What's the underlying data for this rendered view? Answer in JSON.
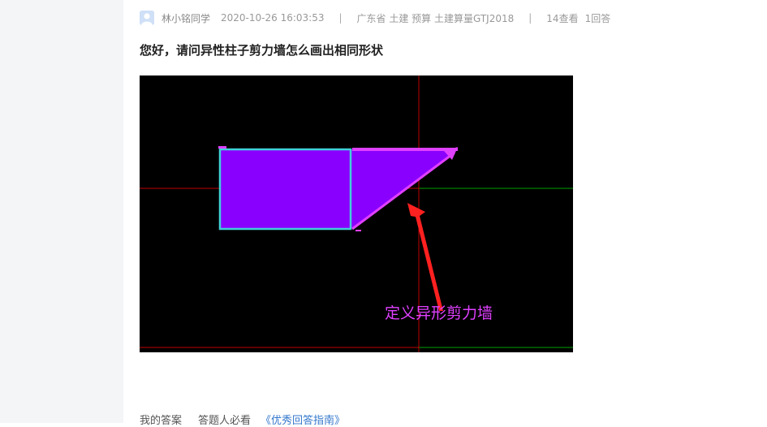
{
  "post": {
    "author": "林小铭同学",
    "date": "2020-10-26 16:03:53",
    "separator": "|",
    "tags": "广东省  土建  预算  土建算量GTJ2018",
    "views": "14查看",
    "answers": "1回答",
    "title": "您好，请问异性柱子剪力墙怎么画出相同形状"
  },
  "image": {
    "annotation_text": "定义异形剪力墙"
  },
  "answer_bar": {
    "my_answer": "我的答案",
    "must_read": "答题人必看",
    "guide_link": "《优秀回答指南》"
  },
  "colors": {
    "fill": "#8a00ff",
    "outline": "#3fd0d8",
    "annotation": "#e040ff",
    "arrow": "#ff2020",
    "axis_red": "#c00000",
    "axis_green": "#00a000"
  }
}
